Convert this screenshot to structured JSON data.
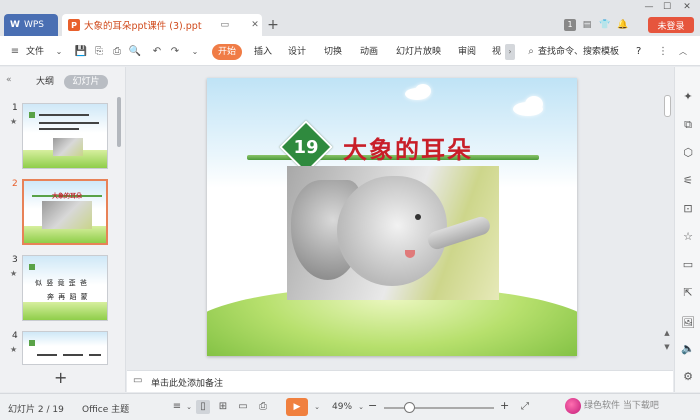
{
  "titlebar": {
    "wps_tab_label": "WPS",
    "doc_tab_label": "大象的耳朵ppt课件 (3).ppt",
    "add_tab": "+",
    "badge_count": "1",
    "login_label": "未登录"
  },
  "menubar": {
    "file_label": "文件",
    "start_label": "开始",
    "items": [
      "插入",
      "设计",
      "切换",
      "动画",
      "幻灯片放映",
      "审阅",
      "视"
    ],
    "search_label": "查找命令、搜索模板",
    "help": "?"
  },
  "leftpanel": {
    "tab_outline": "大纲",
    "tab_slides": "幻灯片",
    "slide_numbers": [
      "1",
      "2",
      "3",
      "4"
    ],
    "thumb2_title": "大象的耳朵",
    "thumb3_chars_1": "似 竖 竟 歪 爸",
    "thumb3_chars_2": "奔 再 蹈 蒙",
    "add_slide": "+"
  },
  "slide": {
    "lesson_number": "19",
    "title": "大象的耳朵"
  },
  "notes": {
    "placeholder": "单击此处添加备注"
  },
  "statusbar": {
    "slide_counter": "幻灯片 2 / 19",
    "theme": "Office 主题",
    "zoom": "49%",
    "minus": "−",
    "plus": "+"
  },
  "watermark": {
    "text": "绿色软件 当下载吧"
  },
  "colors": {
    "accent_orange": "#f07c46",
    "title_red": "#c81e28",
    "badge_green": "#2f8a3e",
    "login_red": "#e6553d"
  }
}
